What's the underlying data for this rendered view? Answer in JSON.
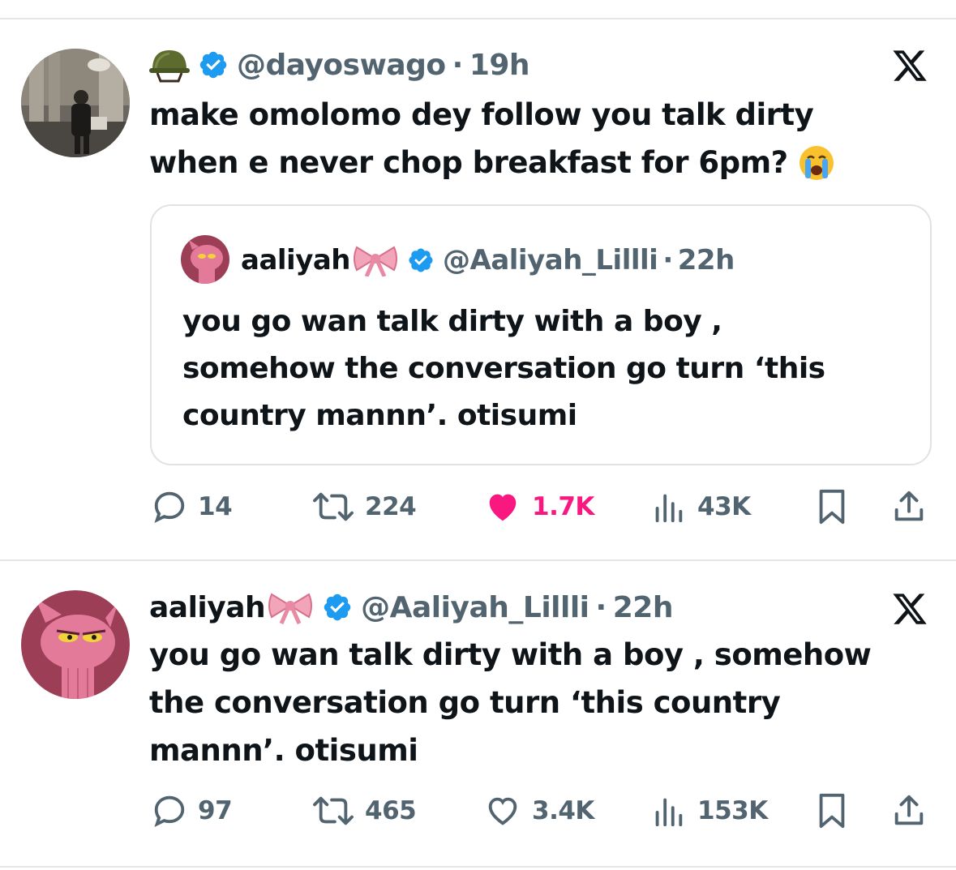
{
  "tweet1": {
    "handle": "@dayoswago",
    "time": "19h",
    "emoji": "🪖",
    "text_line1": "make omolomo dey follow you talk dirty",
    "text_line2": "when e never chop breakfast for 6pm?",
    "text_emoji": "😭",
    "quote": {
      "name": "aaliyah",
      "name_emoji": "🎀",
      "handle": "@Aaliyah_Lillli",
      "time": "22h",
      "text_line1": "you go wan talk dirty with a boy ,",
      "text_line2": "somehow the conversation go turn ‘this",
      "text_line3": "country mannn’. otisumi"
    },
    "replies": "14",
    "reposts": "224",
    "likes": "1.7K",
    "views": "43K"
  },
  "tweet2": {
    "name": "aaliyah",
    "name_emoji": "🎀",
    "handle": "@Aaliyah_Lillli",
    "time": "22h",
    "text_line1": "you go wan talk dirty with a boy , somehow",
    "text_line2": "the conversation go turn ‘this country",
    "text_line3": "mannn’. otisumi",
    "replies": "97",
    "reposts": "465",
    "likes": "3.4K",
    "views": "153K"
  },
  "icons": [
    "helmet-emoji",
    "verified-badge",
    "x-logo",
    "reply-icon",
    "repost-icon",
    "like-icon",
    "views-icon",
    "bookmark-icon",
    "share-icon"
  ],
  "colors": {
    "text": "#0f1419",
    "muted": "#536471",
    "verified": "#1d9bf0",
    "like": "#f91880",
    "divider": "#e6e6e6"
  }
}
